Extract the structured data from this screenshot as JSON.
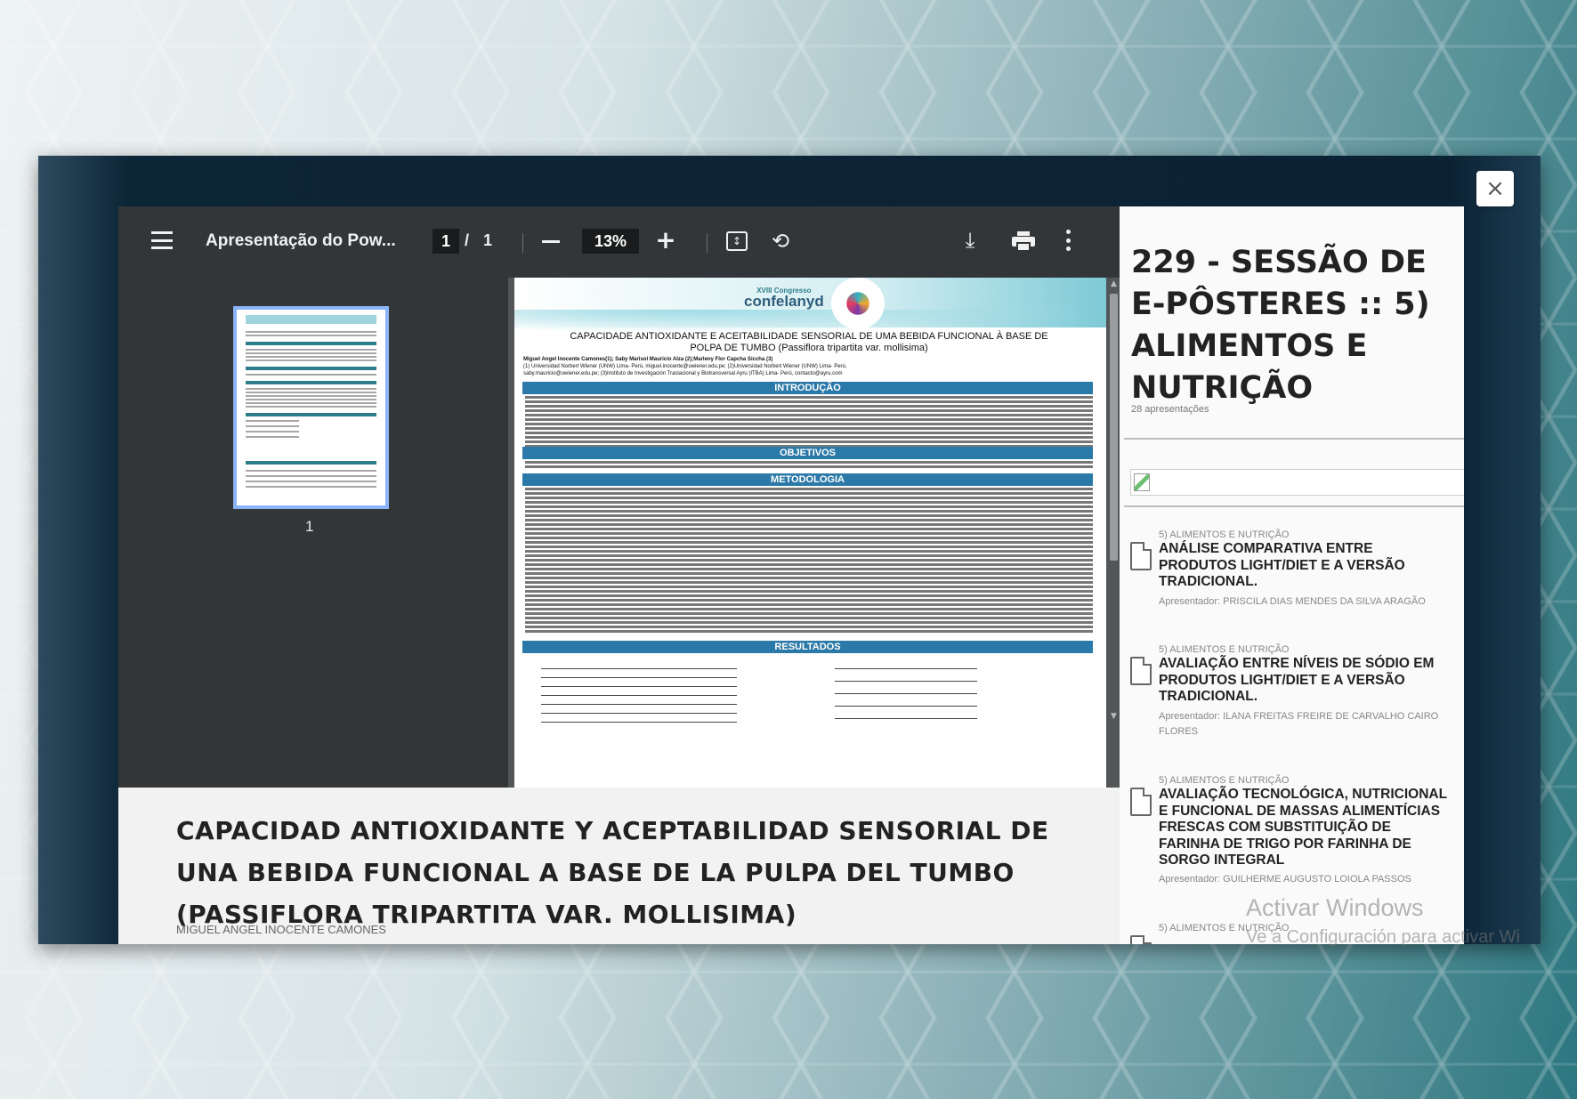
{
  "viewer": {
    "doc_title": "Apresentação do Pow...",
    "page_current": "1",
    "page_sep": "/",
    "page_total": "1",
    "zoom": "13%",
    "thumb_label": "1"
  },
  "poster": {
    "logo_small": "XVIII Congresso",
    "logo_name": "confelanyd",
    "title_line1": "CAPACIDADE ANTIOXIDANTE E ACEITABILIDADE SENSORIAL DE UMA BEBIDA FUNCIONAL À BASE DE",
    "title_line2": "POLPA DE TUMBO (Passiflora tripartita var. mollisima)",
    "authors": "Miguel Angel Inocente Camones(1); Saby Marisol Mauricio Alza (2);Marleny Flor Capcha Siccha (3)",
    "affil1": "(1) Universidad Norbert Wiener (UNW) Lima- Perú, miguel.inocente@uwiener.edu.pe; (2)Universidad Norbert Wiener (UNW) Lima- Perú,",
    "affil2": "saby.mauricio@uwiener.edu.pe; (3)Instituto de Investigación Traslacional y Biotransversal Ayru (ITBA) Lima- Perú, contacto@ayru.com",
    "sections": [
      "INTRODUÇÃO",
      "OBJETIVOS",
      "METODOLOGIA",
      "RESULTADOS"
    ]
  },
  "bottom": {
    "title": "CAPACIDAD ANTIOXIDANTE Y ACEPTABILIDAD SENSORIAL DE UNA BEBIDA FUNCIONAL A BASE DE LA PULPA DEL TUMBO (PASSIFLORA TRIPARTITA VAR. MOLLISIMA)",
    "author": "MIGUEL ANGEL INOCENTE CAMONES"
  },
  "side": {
    "title": "229 - SESSÃO DE E-PÔSTERES :: 5) ALIMENTOS E NUTRIÇÃO",
    "count": "28 apresentações",
    "items": [
      {
        "category": "5) ALIMENTOS E NUTRIÇÃO",
        "title": "ANÁLISE COMPARATIVA ENTRE PRODUTOS LIGHT/DIET E A VERSÃO TRADICIONAL.",
        "presenter": "Apresentador: PRISCILA DIAS MENDES DA SILVA ARAGÃO"
      },
      {
        "category": "5) ALIMENTOS E NUTRIÇÃO",
        "title": "AVALIAÇÃO ENTRE NÍVEIS DE SÓDIO EM PRODUTOS LIGHT/DIET E A VERSÃO TRADICIONAL.",
        "presenter": "Apresentador: ILANA FREITAS FREIRE DE CARVALHO CAIRO FLORES"
      },
      {
        "category": "5) ALIMENTOS E NUTRIÇÃO",
        "title": "AVALIAÇÃO TECNOLÓGICA, NUTRICIONAL E FUNCIONAL DE MASSAS ALIMENTÍCIAS FRESCAS COM SUBSTITUIÇÃO DE FARINHA DE TRIGO POR FARINHA DE SORGO INTEGRAL",
        "presenter": "Apresentador: GUILHERME AUGUSTO LOIOLA PASSOS"
      },
      {
        "category": "5) ALIMENTOS E NUTRIÇÃO",
        "title": "",
        "presenter": ""
      }
    ]
  },
  "watermark": {
    "line1": "Activar Windows",
    "line2": "Ve a Configuración para activar Wi"
  },
  "close_label": "×"
}
